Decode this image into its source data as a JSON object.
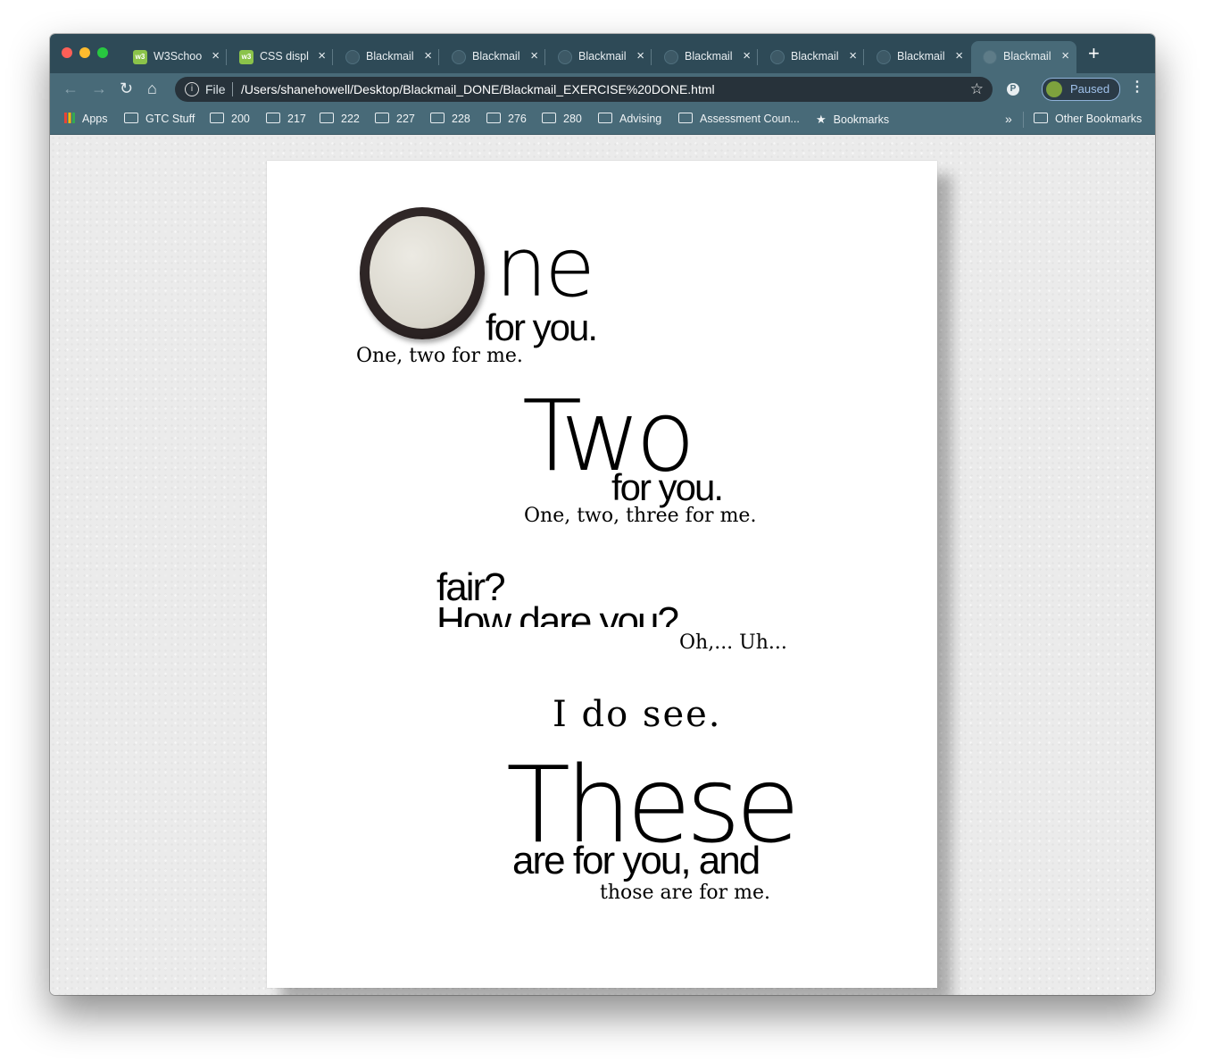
{
  "browser": {
    "tabs": [
      {
        "title": "W3Schoo",
        "favicon": "w3schools-icon",
        "active": false
      },
      {
        "title": "CSS displ",
        "favicon": "w3schools-icon",
        "active": false
      },
      {
        "title": "Blackmail",
        "favicon": "globe-icon",
        "active": false
      },
      {
        "title": "Blackmail",
        "favicon": "globe-icon",
        "active": false
      },
      {
        "title": "Blackmail",
        "favicon": "globe-icon",
        "active": false
      },
      {
        "title": "Blackmail",
        "favicon": "globe-icon",
        "active": false
      },
      {
        "title": "Blackmail",
        "favicon": "globe-icon",
        "active": false
      },
      {
        "title": "Blackmail",
        "favicon": "globe-icon",
        "active": false
      },
      {
        "title": "Blackmail",
        "favicon": "globe-icon",
        "active": true
      }
    ],
    "omnibox": {
      "scheme": "File",
      "url": "/Users/shanehowell/Desktop/Blackmail_DONE/Blackmail_EXERCISE%20DONE.html"
    },
    "profile": {
      "label": "Paused"
    },
    "bookmarks": [
      {
        "label": "Apps",
        "icon": "apps-grid-icon"
      },
      {
        "label": "GTC Stuff",
        "icon": "folder-icon"
      },
      {
        "label": "200",
        "icon": "folder-icon"
      },
      {
        "label": "217",
        "icon": "folder-icon"
      },
      {
        "label": "222",
        "icon": "folder-icon"
      },
      {
        "label": "227",
        "icon": "folder-icon"
      },
      {
        "label": "228",
        "icon": "folder-icon"
      },
      {
        "label": "276",
        "icon": "folder-icon"
      },
      {
        "label": "280",
        "icon": "folder-icon"
      },
      {
        "label": "Advising",
        "icon": "folder-icon"
      },
      {
        "label": "Assessment Coun...",
        "icon": "folder-icon"
      },
      {
        "label": "Bookmarks",
        "icon": "star-icon"
      }
    ],
    "overflow": "»",
    "other_bookmarks": "Other Bookmarks"
  },
  "poem": {
    "one_word": "ne",
    "one_sub": "for you.",
    "one_small": "One, two for me.",
    "two_word": "Two",
    "two_sub": "for you.",
    "two_small": "One, two, three for me.",
    "fair": "fair?",
    "dare": "How dare you?",
    "oh": "Oh,... Uh...",
    "see": "I do see.",
    "these_word": "These",
    "these_sub": "are for you, and",
    "these_small": "those are for me."
  }
}
